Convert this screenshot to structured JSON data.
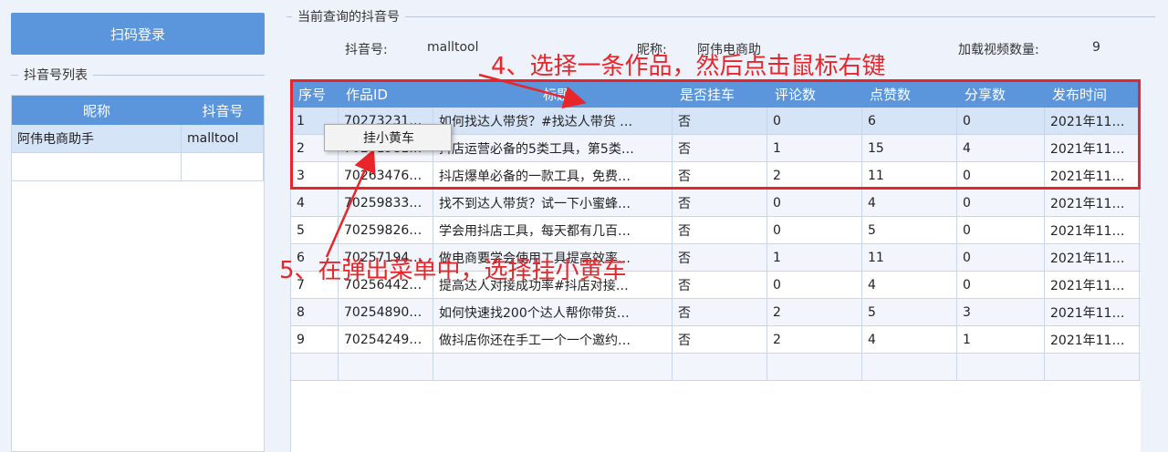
{
  "sidebar": {
    "login_button": "扫码登录",
    "list_legend": "抖音号列表",
    "columns": [
      "昵称",
      "抖音号"
    ],
    "rows": [
      {
        "nickname": "阿伟电商助手",
        "account": "malltool"
      },
      {
        "nickname": "",
        "account": ""
      }
    ]
  },
  "query": {
    "legend": "当前查询的抖音号",
    "account_label": "抖音号:",
    "account_value": "malltool",
    "nickname_label": "昵称:",
    "nickname_value": "阿伟电商助",
    "count_label": "加载视频数量:",
    "count_value": "9"
  },
  "table": {
    "columns": [
      "序号",
      "作品ID",
      "标题",
      "是否挂车",
      "评论数",
      "点赞数",
      "分享数",
      "发布时间"
    ],
    "rows": [
      [
        "1",
        "70273231…",
        "如何找达人带货？#找达人带货 …",
        "否",
        "0",
        "6",
        "0",
        "2021年11…"
      ],
      [
        "2",
        "70271981…",
        "抖店运营必备的5类工具，第5类…",
        "否",
        "1",
        "15",
        "4",
        "2021年11…"
      ],
      [
        "3",
        "70263476…",
        "抖店爆单必备的一款工具，免费…",
        "否",
        "2",
        "11",
        "0",
        "2021年11…"
      ],
      [
        "4",
        "70259833…",
        "找不到达人带货？试一下小蜜蜂…",
        "否",
        "0",
        "4",
        "0",
        "2021年11…"
      ],
      [
        "5",
        "70259826…",
        "学会用抖店工具，每天都有几百…",
        "否",
        "0",
        "5",
        "0",
        "2021年11…"
      ],
      [
        "6",
        "70257194…",
        "做电商要学会使用工具提高效率…",
        "否",
        "1",
        "11",
        "0",
        "2021年11…"
      ],
      [
        "7",
        "70256442…",
        "提高达人对接成功率#抖店对接…",
        "否",
        "0",
        "4",
        "0",
        "2021年11…"
      ],
      [
        "8",
        "70254890…",
        "如何快速找200个达人帮你带货…",
        "否",
        "2",
        "5",
        "3",
        "2021年11…"
      ],
      [
        "9",
        "70254249…",
        "做抖店你还在手工一个一个邀约…",
        "否",
        "2",
        "4",
        "1",
        "2021年11…"
      ],
      [
        "",
        "",
        "",
        "",
        "",
        "",
        "",
        ""
      ]
    ]
  },
  "context_menu": {
    "item": "挂小黄车"
  },
  "annotations": {
    "step4": "4、选择一条作品，然后点击鼠标右键",
    "step5": "5、在弹出菜单中，选择挂小黄车"
  },
  "colors": {
    "header_blue": "#5b95dc",
    "annotation_red": "#e8262a",
    "selected_row": "#d6e4f7"
  }
}
